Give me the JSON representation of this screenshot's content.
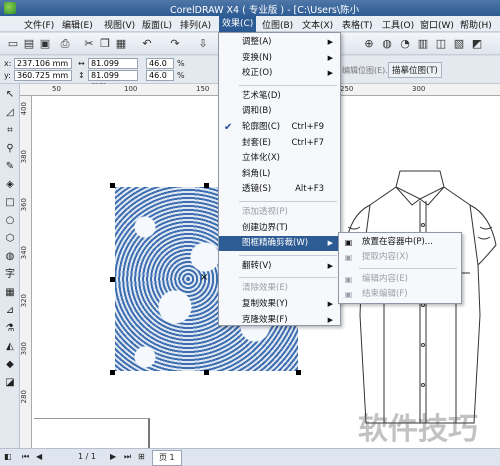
{
  "window": {
    "title": "CorelDRAW X4 ( 专业版 ) - [C:\\Users\\陈小"
  },
  "menubar": [
    {
      "label": "文件(F)",
      "active": false
    },
    {
      "label": "编辑(E)",
      "active": false
    },
    {
      "label": "视图(V)",
      "active": false
    },
    {
      "label": "版面(L)",
      "active": false
    },
    {
      "label": "排列(A)",
      "active": false
    },
    {
      "label": "效果(C)",
      "active": true
    },
    {
      "label": "位图(B)",
      "active": false
    },
    {
      "label": "文本(X)",
      "active": false
    },
    {
      "label": "表格(T)",
      "active": false
    },
    {
      "label": "工具(O)",
      "active": false
    },
    {
      "label": "窗口(W)",
      "active": false
    },
    {
      "label": "帮助(H)",
      "active": false
    }
  ],
  "property_bar": {
    "x_label": "x:",
    "x_value": "237.106 mm",
    "y_label": "y:",
    "y_value": "360.725 mm",
    "w_value": "81.099 mm",
    "h_value": "81.099 mm",
    "scale_w": "46.0",
    "scale_h": "46.0",
    "pct": "%",
    "btn_edit_bitmap": "编辑位图(E)...",
    "btn_trace_bitmap": "描摹位图(T)"
  },
  "hruler": [
    "50",
    "100",
    "150",
    "200",
    "250",
    "300"
  ],
  "vruler": [
    "400",
    "380",
    "360",
    "340",
    "320",
    "300",
    "280"
  ],
  "effects_menu": [
    {
      "label": "调整(A)",
      "shortcut": "",
      "arrow": true,
      "disabled": false,
      "checked": false,
      "highlight": false
    },
    {
      "label": "变换(N)",
      "shortcut": "",
      "arrow": true,
      "disabled": false,
      "checked": false,
      "highlight": false
    },
    {
      "label": "校正(O)",
      "shortcut": "",
      "arrow": true,
      "disabled": false,
      "checked": false,
      "highlight": false
    },
    {
      "sep": true
    },
    {
      "label": "艺术笔(D)",
      "shortcut": "",
      "arrow": false,
      "disabled": false,
      "checked": false,
      "highlight": false
    },
    {
      "label": "调和(B)",
      "shortcut": "",
      "arrow": false,
      "disabled": false,
      "checked": false,
      "highlight": false
    },
    {
      "label": "轮廓图(C)",
      "shortcut": "Ctrl+F9",
      "arrow": false,
      "disabled": false,
      "checked": true,
      "highlight": false
    },
    {
      "label": "封套(E)",
      "shortcut": "Ctrl+F7",
      "arrow": false,
      "disabled": false,
      "checked": false,
      "highlight": false
    },
    {
      "label": "立体化(X)",
      "shortcut": "",
      "arrow": false,
      "disabled": false,
      "checked": false,
      "highlight": false
    },
    {
      "label": "斜角(L)",
      "shortcut": "",
      "arrow": false,
      "disabled": false,
      "checked": false,
      "highlight": false
    },
    {
      "label": "透镜(S)",
      "shortcut": "Alt+F3",
      "arrow": false,
      "disabled": false,
      "checked": false,
      "highlight": false
    },
    {
      "sep": true
    },
    {
      "label": "添加透视(P)",
      "shortcut": "",
      "arrow": false,
      "disabled": true,
      "checked": false,
      "highlight": false
    },
    {
      "label": "创建边界(T)",
      "shortcut": "",
      "arrow": false,
      "disabled": false,
      "checked": false,
      "highlight": false
    },
    {
      "label": "图框精确剪裁(W)",
      "shortcut": "",
      "arrow": true,
      "disabled": false,
      "checked": false,
      "highlight": true
    },
    {
      "sep": true
    },
    {
      "label": "翻转(V)",
      "shortcut": "",
      "arrow": true,
      "disabled": false,
      "checked": false,
      "highlight": false
    },
    {
      "sep": true
    },
    {
      "label": "清除效果(E)",
      "shortcut": "",
      "arrow": false,
      "disabled": true,
      "checked": false,
      "highlight": false
    },
    {
      "label": "复制效果(Y)",
      "shortcut": "",
      "arrow": true,
      "disabled": false,
      "checked": false,
      "highlight": false
    },
    {
      "label": "克隆效果(F)",
      "shortcut": "",
      "arrow": true,
      "disabled": false,
      "checked": false,
      "highlight": false
    }
  ],
  "powerclip_menu": [
    {
      "label": "放置在容器中(P)...",
      "disabled": false
    },
    {
      "label": "提取内容(X)",
      "disabled": true
    },
    {
      "sep": true
    },
    {
      "label": "编辑内容(E)",
      "disabled": true
    },
    {
      "label": "结束编辑(F)",
      "disabled": true
    }
  ],
  "page_bar": {
    "page_counter": "1 / 1",
    "page_tab": "页 1"
  },
  "watermark": "软件技巧"
}
